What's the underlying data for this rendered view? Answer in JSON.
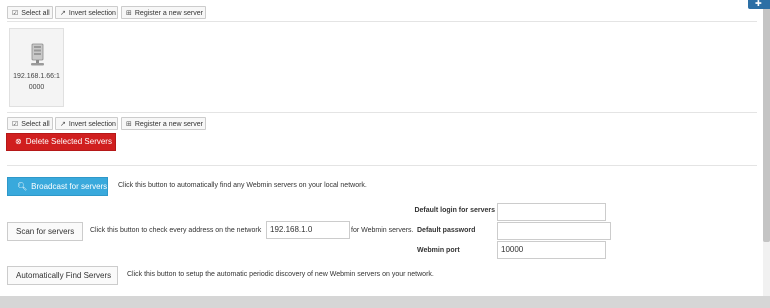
{
  "toolbar_top": {
    "select_all": "Select all",
    "invert_selection": "Invert selection",
    "register_server": "Register a new server"
  },
  "servers": [
    {
      "label": "192.168.1.66:10000",
      "icon": "server-icon"
    }
  ],
  "toolbar_bottom": {
    "select_all": "Select all",
    "invert_selection": "Invert selection",
    "register_server": "Register a new server"
  },
  "delete_button": "Delete Selected Servers",
  "broadcast": {
    "button": "Broadcast for servers",
    "description": "Click this button to automatically find any Webmin servers on your local network."
  },
  "scan": {
    "button": "Scan for servers",
    "description_before": "Click this button to check every address on the network",
    "network_value": "192.168.1.0",
    "description_after": "for Webmin servers."
  },
  "settings": {
    "default_login_label": "Default login for servers",
    "default_login_value": "",
    "default_password_label": "Default password",
    "default_password_value": "",
    "webmin_port_label": "Webmin port",
    "webmin_port_value": "10000"
  },
  "auto_find": {
    "button": "Automatically Find Servers",
    "description": "Click this button to setup the automatic periodic discovery of new Webmin servers on your network."
  },
  "colors": {
    "danger": "#d01f1f",
    "primary": "#39a9dc",
    "corner_tab": "#2c6fa5"
  }
}
